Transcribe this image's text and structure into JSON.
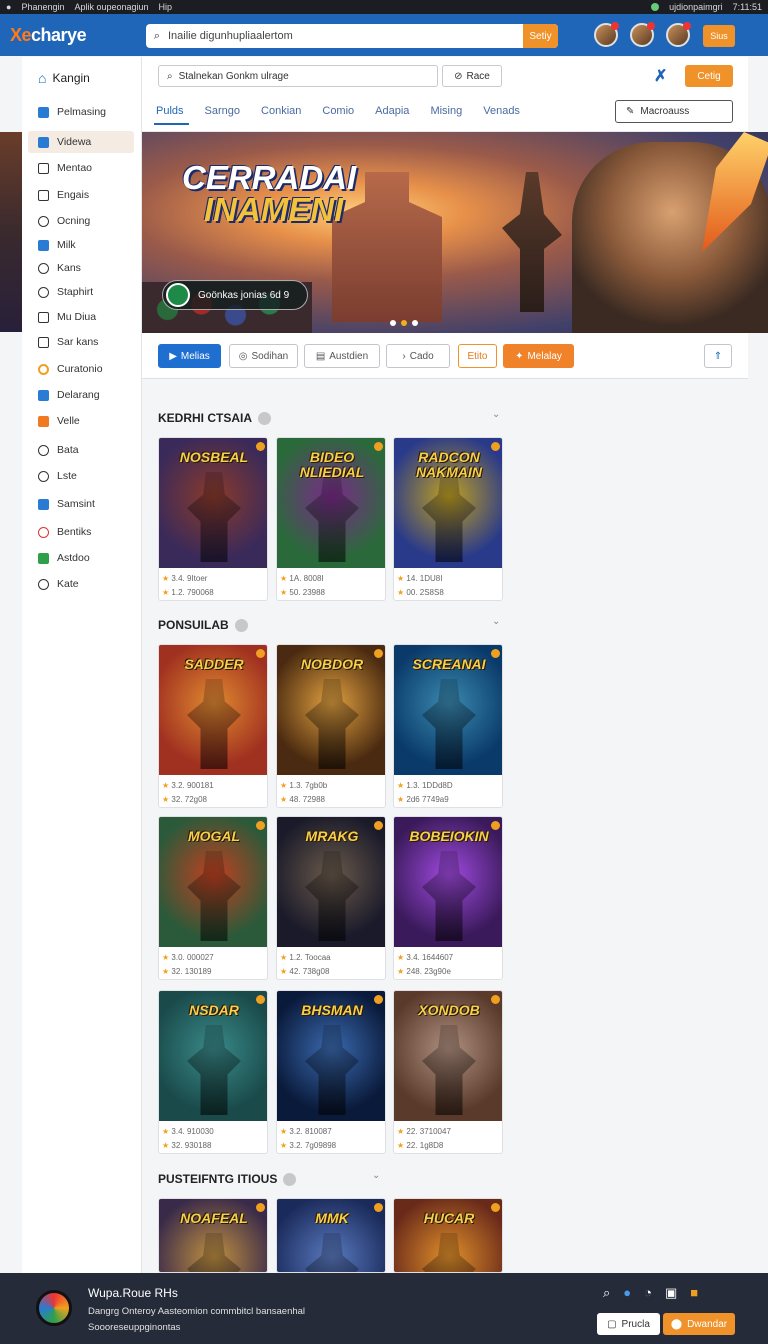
{
  "os_bar": {
    "items": [
      "Phanengin",
      "Aplik oupeonagiun",
      "Hip",
      "ujdionpaimgri"
    ],
    "time": "7:11:51"
  },
  "app": {
    "logo_prefix": "Xe",
    "logo_rest": "charye",
    "search_placeholder": "Inailie digunhupliaalertom",
    "search_button": "Setiy",
    "top_button": "Sius"
  },
  "sidebar": {
    "header": "Kangin",
    "items": [
      {
        "label": "Pelmasing",
        "icon": "blue"
      },
      {
        "label": "Videwa",
        "icon": "blue",
        "active": true
      },
      {
        "label": "Mentao",
        "icon": "sq"
      },
      {
        "label": "Engais",
        "icon": "sq"
      },
      {
        "label": "Ocning",
        "icon": "circ"
      },
      {
        "label": "Milk",
        "icon": "blue"
      },
      {
        "label": "Kans",
        "icon": "circ"
      },
      {
        "label": "Staphirt",
        "icon": "circ"
      },
      {
        "label": "Mu Diua",
        "icon": "sq"
      },
      {
        "label": "Sar kans",
        "icon": "sq"
      },
      {
        "label": "Curatonio",
        "icon": "ylw"
      },
      {
        "label": "Delarang",
        "icon": "blue"
      },
      {
        "label": "Velle",
        "icon": "orange"
      },
      {
        "label": "Bata",
        "icon": "circ"
      },
      {
        "label": "Lste",
        "icon": "circ"
      },
      {
        "label": "Samsint",
        "icon": "blue"
      },
      {
        "label": "Bentiks",
        "icon": "red"
      },
      {
        "label": "Astdoo",
        "icon": "green"
      },
      {
        "label": "Kate",
        "icon": "circ"
      }
    ]
  },
  "panel": {
    "search_placeholder": "Stalnekan Gonkm ulrage",
    "search_button": "Race",
    "action_button": "Cetig",
    "tabs": [
      "Pulds",
      "Sarngo",
      "Conkian",
      "Comio",
      "Adapia",
      "Mising",
      "Venads"
    ],
    "outline_button": "Macroauss"
  },
  "hero": {
    "title_line1": "CERRADAI",
    "title_line2": "INAMENI",
    "chip": "Goönkas jonias 6d 9"
  },
  "actions": [
    "Melias",
    "Sodihan",
    "Austdien",
    "Cado",
    "Etito",
    "Melalay"
  ],
  "sections": [
    {
      "title": "KEDRHI CTSAIA",
      "cards": [
        {
          "title": "NOSBEAL",
          "line1": "3.4. 9Itoer",
          "line2": "1.2. 790068"
        },
        {
          "title": "BIDEO NLIEDIAL",
          "line1": "1A. 8008I",
          "line2": "50. 23988"
        },
        {
          "title": "RADCON NAKMAIN",
          "line1": "14. 1DU8I",
          "line2": "00. 2S8S8"
        }
      ]
    },
    {
      "title": "PONSUILAB",
      "cards": [
        {
          "title": "SADDER",
          "line1": "3.2. 900181",
          "line2": "32. 72g08"
        },
        {
          "title": "NOBDOR",
          "line1": "1.3. 7gb0b",
          "line2": "48. 72988"
        },
        {
          "title": "SCREANAI",
          "line1": "1.3. 1DDd8D",
          "line2": "2d6 7749a9"
        },
        {
          "title": "MOGAL",
          "line1": "3.0. 000027",
          "line2": "32. 130189"
        },
        {
          "title": "MRAKG",
          "line1": "1.2. Toocaa",
          "line2": "42. 738g08"
        },
        {
          "title": "BOBEIOKIN",
          "line1": "3.4. 1644607",
          "line2": "248. 23g90e"
        },
        {
          "title": "NSDAR",
          "line1": "3.4. 910030",
          "line2": "32. 930188"
        },
        {
          "title": "BHSMAN",
          "line1": "3.2. 810087",
          "line2": "3.2. 7g09898"
        },
        {
          "title": "XONDOB",
          "line1": "22. 3710047",
          "line2": "22. 1g8D8"
        }
      ]
    },
    {
      "title": "PUSTEIFNTG ITIOUS",
      "cards": [
        {
          "title": "NOAFEAL",
          "line1": "",
          "line2": ""
        },
        {
          "title": "MMK",
          "line1": "",
          "line2": ""
        },
        {
          "title": "HUCAR",
          "line1": "",
          "line2": ""
        }
      ]
    }
  ],
  "footer": {
    "title": "Wupa.Roue RHs",
    "line1": "Dangrg Onteroy Aasteomion commbitcl bansaenhal",
    "line2": "Soooreseuppginontas",
    "btn1": "Prucla",
    "btn2": "Dwandar"
  }
}
